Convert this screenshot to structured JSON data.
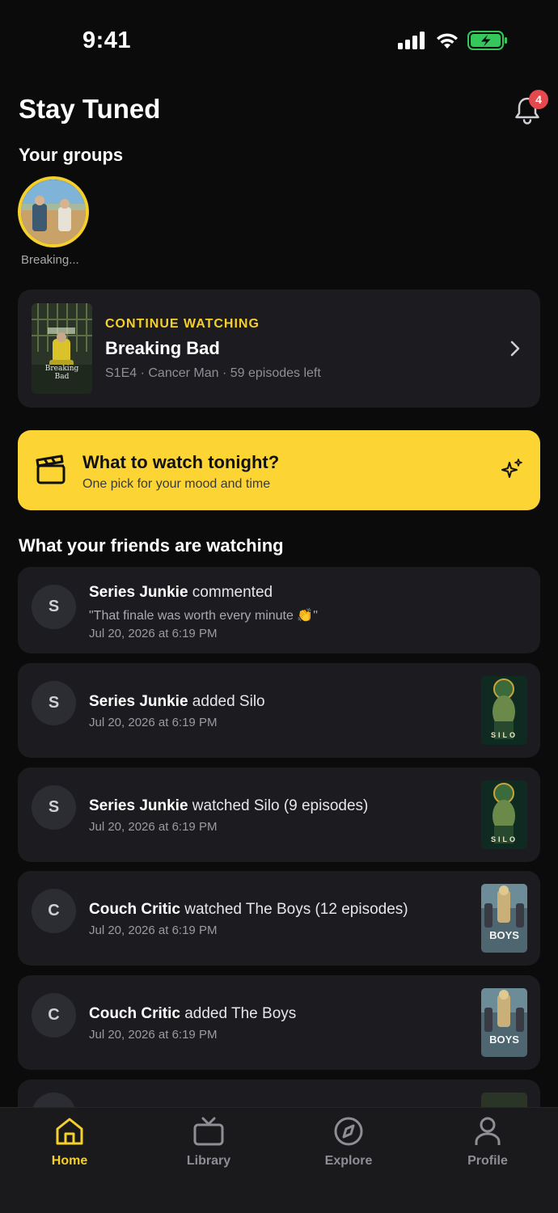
{
  "status": {
    "time": "9:41"
  },
  "header": {
    "title": "Stay Tuned",
    "notifications_count": "4"
  },
  "groups": {
    "title": "Your groups",
    "items": [
      {
        "label": "Breaking..."
      }
    ]
  },
  "continue": {
    "kicker": "CONTINUE WATCHING",
    "title": "Breaking Bad",
    "meta": "S1E4 · Cancer Man · 59 episodes left",
    "poster_text_1": "Breaking",
    "poster_text_2": "Bad"
  },
  "tonight": {
    "title": "What to watch tonight?",
    "subtitle": "One pick for your mood and time"
  },
  "friends": {
    "title": "What your friends are watching",
    "items": [
      {
        "initial": "S",
        "user": "Series Junkie",
        "action": " commented",
        "quote": "\"That finale was worth every minute 👏\"",
        "date": "Jul 20, 2026 at 6:19 PM",
        "thumb": ""
      },
      {
        "initial": "S",
        "user": "Series Junkie",
        "action": " added Silo",
        "quote": "",
        "date": "Jul 20, 2026 at 6:19 PM",
        "thumb": "SILO"
      },
      {
        "initial": "S",
        "user": "Series Junkie",
        "action": " watched Silo (9 episodes)",
        "quote": "",
        "date": "Jul 20, 2026 at 6:19 PM",
        "thumb": "SILO"
      },
      {
        "initial": "C",
        "user": "Couch Critic",
        "action": " watched The Boys (12 episodes)",
        "quote": "",
        "date": "Jul 20, 2026 at 6:19 PM",
        "thumb": "BOYS"
      },
      {
        "initial": "C",
        "user": "Couch Critic",
        "action": " added The Boys",
        "quote": "",
        "date": "Jul 20, 2026 at 6:19 PM",
        "thumb": "BOYS"
      }
    ]
  },
  "tabs": [
    {
      "label": "Home",
      "active": true
    },
    {
      "label": "Library",
      "active": false
    },
    {
      "label": "Explore",
      "active": false
    },
    {
      "label": "Profile",
      "active": false
    }
  ],
  "colors": {
    "accent": "#f5cf2a",
    "card": "#1c1c20",
    "background": "#0b0b0c",
    "badge": "#e5484d"
  }
}
